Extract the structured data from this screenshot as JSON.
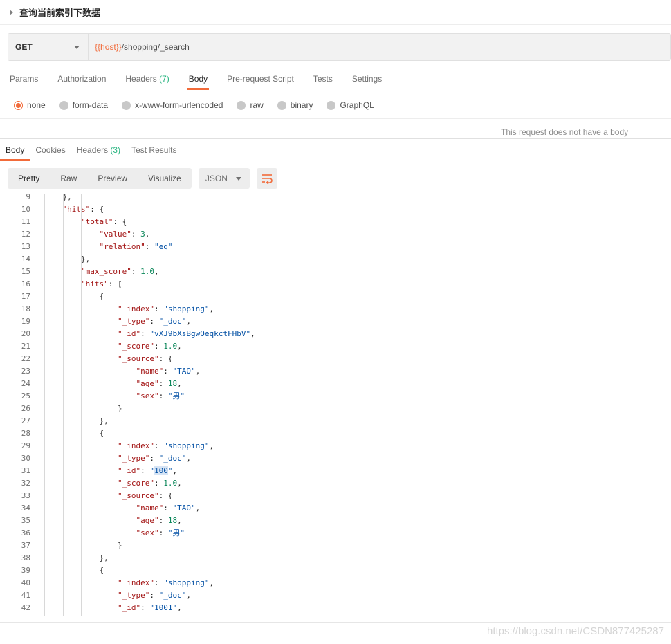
{
  "request": {
    "title": "查询当前索引下数据",
    "method": "GET",
    "url_var": "{{host}}",
    "url_path": "/shopping/_search"
  },
  "request_tabs": [
    {
      "label": "Params"
    },
    {
      "label": "Authorization"
    },
    {
      "label": "Headers",
      "count": "(7)"
    },
    {
      "label": "Body",
      "active": true
    },
    {
      "label": "Pre-request Script"
    },
    {
      "label": "Tests"
    },
    {
      "label": "Settings"
    }
  ],
  "body_types": [
    {
      "label": "none",
      "selected": true
    },
    {
      "label": "form-data"
    },
    {
      "label": "x-www-form-urlencoded"
    },
    {
      "label": "raw"
    },
    {
      "label": "binary"
    },
    {
      "label": "GraphQL"
    }
  ],
  "no_body_message": "This request does not have a body",
  "response_tabs": [
    {
      "label": "Body",
      "active": true
    },
    {
      "label": "Cookies"
    },
    {
      "label": "Headers",
      "count": "(3)"
    },
    {
      "label": "Test Results"
    }
  ],
  "view_modes": [
    "Pretty",
    "Raw",
    "Preview",
    "Visualize"
  ],
  "format": "JSON",
  "wrap_icon": "wrap-lines-icon",
  "accent_color": "#f26b3a",
  "code_lines": [
    {
      "n": "9",
      "indent": 1,
      "parts": [
        [
          "p",
          "},"
        ]
      ]
    },
    {
      "n": "10",
      "indent": 1,
      "parts": [
        [
          "k",
          "\"hits\""
        ],
        [
          "p",
          ": {"
        ]
      ]
    },
    {
      "n": "11",
      "indent": 2,
      "parts": [
        [
          "k",
          "\"total\""
        ],
        [
          "p",
          ": {"
        ]
      ]
    },
    {
      "n": "12",
      "indent": 3,
      "parts": [
        [
          "k",
          "\"value\""
        ],
        [
          "p",
          ": "
        ],
        [
          "n",
          "3"
        ],
        [
          "p",
          ","
        ]
      ]
    },
    {
      "n": "13",
      "indent": 3,
      "parts": [
        [
          "k",
          "\"relation\""
        ],
        [
          "p",
          ": "
        ],
        [
          "s",
          "\"eq\""
        ]
      ]
    },
    {
      "n": "14",
      "indent": 2,
      "parts": [
        [
          "p",
          "},"
        ]
      ]
    },
    {
      "n": "15",
      "indent": 2,
      "parts": [
        [
          "k",
          "\"max_score\""
        ],
        [
          "p",
          ": "
        ],
        [
          "n",
          "1.0"
        ],
        [
          "p",
          ","
        ]
      ]
    },
    {
      "n": "16",
      "indent": 2,
      "parts": [
        [
          "k",
          "\"hits\""
        ],
        [
          "p",
          ": ["
        ]
      ]
    },
    {
      "n": "17",
      "indent": 3,
      "parts": [
        [
          "p",
          "{"
        ]
      ]
    },
    {
      "n": "18",
      "indent": 4,
      "parts": [
        [
          "k",
          "\"_index\""
        ],
        [
          "p",
          ": "
        ],
        [
          "s",
          "\"shopping\""
        ],
        [
          "p",
          ","
        ]
      ]
    },
    {
      "n": "19",
      "indent": 4,
      "parts": [
        [
          "k",
          "\"_type\""
        ],
        [
          "p",
          ": "
        ],
        [
          "s",
          "\"_doc\""
        ],
        [
          "p",
          ","
        ]
      ]
    },
    {
      "n": "20",
      "indent": 4,
      "parts": [
        [
          "k",
          "\"_id\""
        ],
        [
          "p",
          ": "
        ],
        [
          "s",
          "\"vXJ9bXsBgwOeqkctFHbV\""
        ],
        [
          "p",
          ","
        ]
      ]
    },
    {
      "n": "21",
      "indent": 4,
      "parts": [
        [
          "k",
          "\"_score\""
        ],
        [
          "p",
          ": "
        ],
        [
          "n",
          "1.0"
        ],
        [
          "p",
          ","
        ]
      ]
    },
    {
      "n": "22",
      "indent": 4,
      "parts": [
        [
          "k",
          "\"_source\""
        ],
        [
          "p",
          ": {"
        ]
      ]
    },
    {
      "n": "23",
      "indent": 5,
      "parts": [
        [
          "k",
          "\"name\""
        ],
        [
          "p",
          ": "
        ],
        [
          "s",
          "\"TAO\""
        ],
        [
          "p",
          ","
        ]
      ]
    },
    {
      "n": "24",
      "indent": 5,
      "parts": [
        [
          "k",
          "\"age\""
        ],
        [
          "p",
          ": "
        ],
        [
          "n",
          "18"
        ],
        [
          "p",
          ","
        ]
      ]
    },
    {
      "n": "25",
      "indent": 5,
      "parts": [
        [
          "k",
          "\"sex\""
        ],
        [
          "p",
          ": "
        ],
        [
          "s",
          "\"男\""
        ]
      ]
    },
    {
      "n": "26",
      "indent": 4,
      "parts": [
        [
          "p",
          "}"
        ]
      ]
    },
    {
      "n": "27",
      "indent": 3,
      "parts": [
        [
          "p",
          "},"
        ]
      ]
    },
    {
      "n": "28",
      "indent": 3,
      "parts": [
        [
          "p",
          "{"
        ]
      ]
    },
    {
      "n": "29",
      "indent": 4,
      "parts": [
        [
          "k",
          "\"_index\""
        ],
        [
          "p",
          ": "
        ],
        [
          "s",
          "\"shopping\""
        ],
        [
          "p",
          ","
        ]
      ]
    },
    {
      "n": "30",
      "indent": 4,
      "parts": [
        [
          "k",
          "\"_type\""
        ],
        [
          "p",
          ": "
        ],
        [
          "s",
          "\"_doc\""
        ],
        [
          "p",
          ","
        ]
      ]
    },
    {
      "n": "31",
      "indent": 4,
      "parts": [
        [
          "k",
          "\"_id\""
        ],
        [
          "p",
          ": "
        ],
        [
          "s",
          "\""
        ],
        [
          "h",
          "100"
        ],
        [
          "s",
          "\""
        ],
        [
          "p",
          ","
        ]
      ]
    },
    {
      "n": "32",
      "indent": 4,
      "parts": [
        [
          "k",
          "\"_score\""
        ],
        [
          "p",
          ": "
        ],
        [
          "n",
          "1.0"
        ],
        [
          "p",
          ","
        ]
      ]
    },
    {
      "n": "33",
      "indent": 4,
      "parts": [
        [
          "k",
          "\"_source\""
        ],
        [
          "p",
          ": {"
        ]
      ]
    },
    {
      "n": "34",
      "indent": 5,
      "parts": [
        [
          "k",
          "\"name\""
        ],
        [
          "p",
          ": "
        ],
        [
          "s",
          "\"TAO\""
        ],
        [
          "p",
          ","
        ]
      ]
    },
    {
      "n": "35",
      "indent": 5,
      "parts": [
        [
          "k",
          "\"age\""
        ],
        [
          "p",
          ": "
        ],
        [
          "n",
          "18"
        ],
        [
          "p",
          ","
        ]
      ]
    },
    {
      "n": "36",
      "indent": 5,
      "parts": [
        [
          "k",
          "\"sex\""
        ],
        [
          "p",
          ": "
        ],
        [
          "s",
          "\"男\""
        ]
      ]
    },
    {
      "n": "37",
      "indent": 4,
      "parts": [
        [
          "p",
          "}"
        ]
      ]
    },
    {
      "n": "38",
      "indent": 3,
      "parts": [
        [
          "p",
          "},"
        ]
      ]
    },
    {
      "n": "39",
      "indent": 3,
      "parts": [
        [
          "p",
          "{"
        ]
      ]
    },
    {
      "n": "40",
      "indent": 4,
      "parts": [
        [
          "k",
          "\"_index\""
        ],
        [
          "p",
          ": "
        ],
        [
          "s",
          "\"shopping\""
        ],
        [
          "p",
          ","
        ]
      ]
    },
    {
      "n": "41",
      "indent": 4,
      "parts": [
        [
          "k",
          "\"_type\""
        ],
        [
          "p",
          ": "
        ],
        [
          "s",
          "\"_doc\""
        ],
        [
          "p",
          ","
        ]
      ]
    },
    {
      "n": "42",
      "indent": 4,
      "parts": [
        [
          "k",
          "\"_id\""
        ],
        [
          "p",
          ": "
        ],
        [
          "s",
          "\"1001\""
        ],
        [
          "p",
          ","
        ]
      ]
    }
  ],
  "watermark": "https://blog.csdn.net/CSDN877425287"
}
